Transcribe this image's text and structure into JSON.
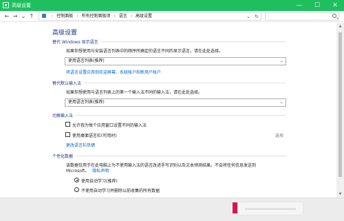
{
  "window": {
    "title": "高级设置",
    "minimize_glyph": "—",
    "maximize_glyph": "☐",
    "close_glyph": "✕",
    "accent_color": "#1fbf60"
  },
  "nav": {
    "back_glyph": "←",
    "forward_glyph": "→",
    "recent_glyph": "⌄",
    "up_glyph": "↑",
    "breadcrumbs": [
      "控制面板",
      "所有控制面板项",
      "语言",
      "高级设置"
    ],
    "crumb_sep": "›",
    "dropdown_glyph": "⌄",
    "refresh_glyph": "↻",
    "search_icon": "magnifier-icon"
  },
  "main": {
    "heading": "高级设置",
    "override_display": {
      "title": "替代 Windows 显示语言",
      "description": "如果你想使用与安装语言列表中的顺序所确定的语言不同的显示语言，请在此处选择。",
      "combo_value": "使用语言列表(推荐)",
      "link": "将语言设置应用到欢迎屏幕、系统帐户和新用户帐户"
    },
    "override_input": {
      "title": "替代默认输入法",
      "description": "如果你想使用与语言列表上的第一个输入法不同的输入法，请在此处选择。",
      "combo_value": "使用语言列表(推荐)"
    },
    "switch_input": {
      "title": "切换输入法",
      "option1": "允许我为每个应用窗口设置不同的输入法",
      "option2": "使用桌面语言栏(可用时)",
      "options_link": "选项",
      "hotkeys_link": "更改语言栏热键"
    },
    "personalization": {
      "title": "个性化数据",
      "description_line1": "该数据仅用于在此电脑上为不使用输入法的语言改进手写识别以及文本预测结果。不会将任何信息发送到",
      "description_line2": "Microsoft。",
      "privacy_link": "隐私声明",
      "radio1": "使用自动学习(推荐)",
      "radio2": "不使用自动学习并删除以前收集的所有数据"
    }
  },
  "footer": {
    "accent_color": "#d4145a"
  }
}
